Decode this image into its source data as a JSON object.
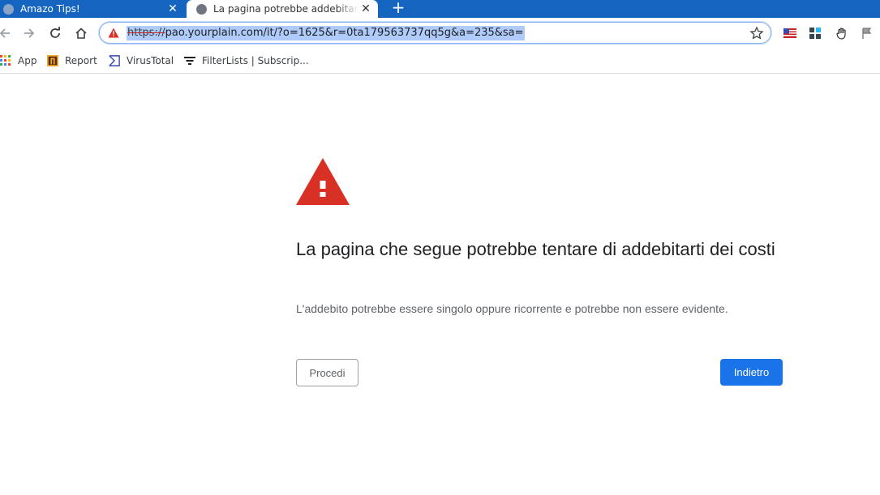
{
  "tabs": [
    {
      "title": "Amazo Tips!",
      "icon": "globe-icon",
      "active": false
    },
    {
      "title": "La pagina potrebbe addebitare c",
      "icon": "globe-icon",
      "active": true
    }
  ],
  "toolbar": {
    "url_scheme": "https://",
    "url_rest": "pao.yourplain.com/it/?o=1625&r=0ta179563737qq5g&a=235&sa=",
    "security_state": "not-secure-warning"
  },
  "bookmarks": [
    {
      "label": "App",
      "icon": "apps-grid-icon"
    },
    {
      "label": "Report",
      "icon": "report-icon"
    },
    {
      "label": "VirusTotal",
      "icon": "virustotal-icon"
    },
    {
      "label": "FilterLists | Subscrip...",
      "icon": "filter-icon"
    }
  ],
  "interstitial": {
    "heading": "La pagina che segue potrebbe tentare di addebitarti dei costi",
    "description": "L'addebito potrebbe essere singolo oppure ricorrente e potrebbe non essere evidente.",
    "proceed_label": "Procedi",
    "back_label": "Indietro"
  },
  "colors": {
    "tabstrip": "#1565c0",
    "warning_red": "#d93025",
    "primary_button": "#1a73e8"
  }
}
